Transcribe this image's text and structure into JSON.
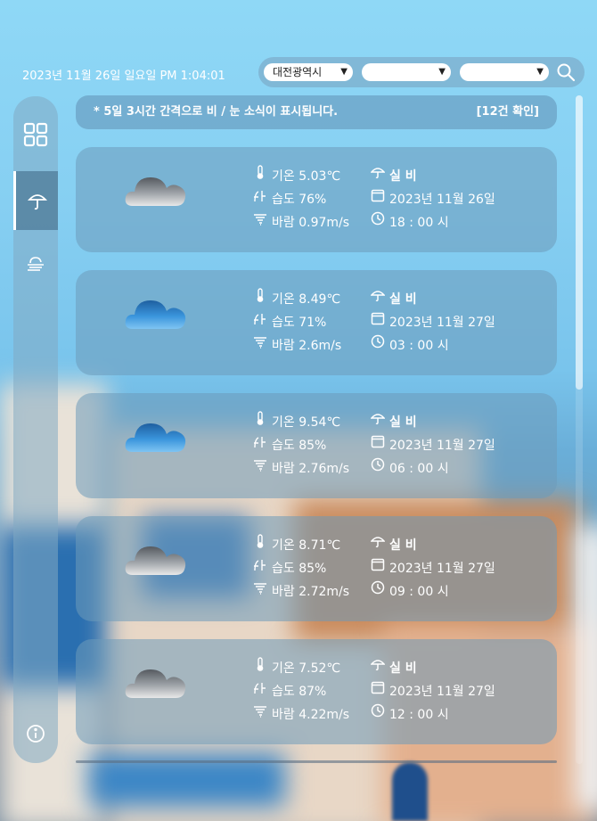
{
  "header": {
    "datetime": "2023년 11월 26일 일요일 PM 1:04:01",
    "region_select": {
      "selected": "대전광역시"
    },
    "district_select": {
      "selected": ""
    },
    "town_select": {
      "selected": ""
    },
    "search_icon": "search-icon"
  },
  "sidebar": {
    "items": [
      {
        "name": "dashboard",
        "icon": "grid-icon",
        "active": false
      },
      {
        "name": "rain",
        "icon": "umbrella-icon",
        "active": true
      },
      {
        "name": "fog",
        "icon": "fog-icon",
        "active": false
      }
    ],
    "info_icon": "info-icon"
  },
  "notice": {
    "message": "* 5일 3시간 간격으로 비 / 눈 소식이 표시됩니다.",
    "count": "[12건 확인]"
  },
  "forecasts": [
    {
      "icon": "rain-cloud-gray",
      "temp": "기온 5.03℃",
      "humidity": "습도 76%",
      "wind": "바람 0.97m/s",
      "precip": "실 비",
      "date": "2023년 11월  26일",
      "time": "18 : 00 시"
    },
    {
      "icon": "rain-cloud-blue",
      "temp": "기온 8.49℃",
      "humidity": "습도 71%",
      "wind": "바람 2.6m/s",
      "precip": "실 비",
      "date": "2023년 11월  27일",
      "time": "03 : 00 시"
    },
    {
      "icon": "rain-cloud-blue",
      "temp": "기온 9.54℃",
      "humidity": "습도 85%",
      "wind": "바람 2.76m/s",
      "precip": "실 비",
      "date": "2023년 11월  27일",
      "time": "06 : 00 시"
    },
    {
      "icon": "rain-cloud-gray",
      "temp": "기온 8.71℃",
      "humidity": "습도 85%",
      "wind": "바람 2.72m/s",
      "precip": "실 비",
      "date": "2023년 11월  27일",
      "time": "09 : 00 시"
    },
    {
      "icon": "rain-cloud-gray",
      "temp": "기온 7.52℃",
      "humidity": "습도 87%",
      "wind": "바람 4.22m/s",
      "precip": "실 비",
      "date": "2023년 11월  27일",
      "time": "12 : 00 시"
    }
  ],
  "colors": {
    "sky_top": "#8fd8f6",
    "card_bg": "rgba(110,155,185,0.55)",
    "gray_cloud": "#9a9a9a",
    "blue_cloud": "#2d86d0"
  }
}
